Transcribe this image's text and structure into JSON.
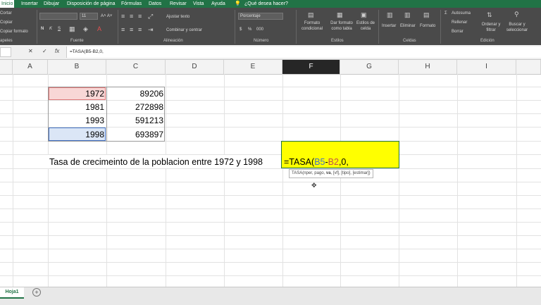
{
  "menu_tabs": [
    "Inicio",
    "Insertar",
    "Dibujar",
    "Disposición de página",
    "Fórmulas",
    "Datos",
    "Revisar",
    "Vista",
    "Ayuda"
  ],
  "tell_me": "¿Qué desea hacer?",
  "ribbon": {
    "clipboard": {
      "cut": "Cortar",
      "copy": "Copiar",
      "format_painter": "Copiar formato",
      "label": "apeles"
    },
    "font": {
      "font_size": "11",
      "bold": "N",
      "italic": "K",
      "underline": "S",
      "label": "Fuente"
    },
    "alignment": {
      "wrap": "Ajustar texto",
      "merge": "Combinar y centrar",
      "label": "Alineación"
    },
    "number": {
      "format": "Porcentaje",
      "currency": "$",
      "percent": "%",
      "thousands": "000",
      "label": "Número"
    },
    "styles": {
      "conditional": "Formato condicional",
      "table": "Dar formato como tabla",
      "cell_styles": "Estilos de celda",
      "label": "Estilos"
    },
    "cells": {
      "insert": "Insertar",
      "delete": "Eliminar",
      "format": "Formato",
      "label": "Celdas"
    },
    "editing": {
      "autosum": "Autosuma",
      "fill": "Rellenar",
      "clear": "Borrar",
      "sort": "Ordenar y filtrar",
      "find": "Buscar y seleccionar",
      "label": "Edición"
    }
  },
  "formula_bar": {
    "cancel": "✕",
    "enter": "✓",
    "fx": "fx",
    "value": "=TASA(B5-B2,0,"
  },
  "columns": [
    "A",
    "B",
    "C",
    "D",
    "E",
    "F",
    "G",
    "H",
    "I"
  ],
  "selected_column": "F",
  "table": [
    {
      "year": "1972",
      "pop": "89206"
    },
    {
      "year": "1981",
      "pop": "272898"
    },
    {
      "year": "1993",
      "pop": "591213"
    },
    {
      "year": "1998",
      "pop": "693897"
    }
  ],
  "label_text": "Tasa de crecimeinto de la poblacion entre 1972 y 1998",
  "active_cell": {
    "text_eq": "=TASA(",
    "ref1": "B5",
    "minus": "-",
    "ref2": "B2",
    "rest": ",0,"
  },
  "tooltip": {
    "prefix": "TASA(nper, pago, ",
    "bold": "va",
    "suffix": ", [vf], [tipo], [estimar])"
  },
  "sheet": {
    "name": "Hoja1",
    "add": "+"
  },
  "colors": {
    "accent": "#217346",
    "yellow": "#ffff00",
    "ref1": "#4472c4",
    "ref2": "#c0504d"
  }
}
